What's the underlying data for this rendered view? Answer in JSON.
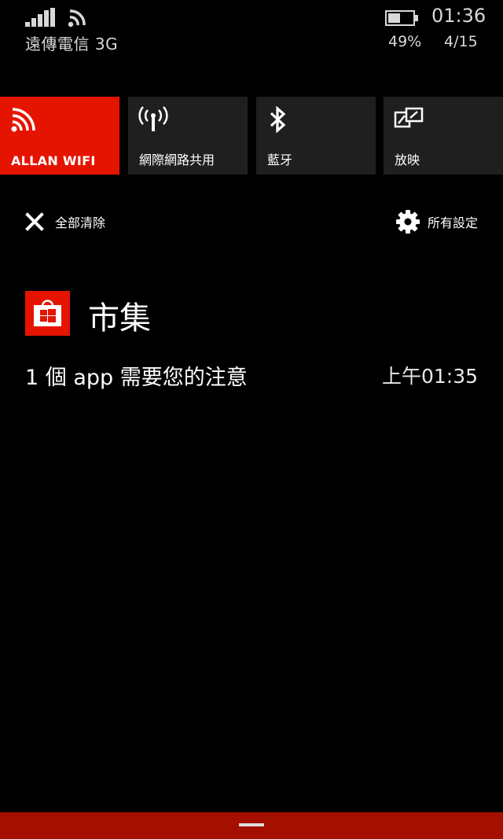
{
  "status_bar": {
    "carrier": "遠傳電信 3G",
    "time": "01:36",
    "battery_percent": "49%",
    "battery_level": 0.49,
    "date": "4/15",
    "icons": [
      "signal-strength-icon",
      "wifi-icon",
      "battery-icon"
    ]
  },
  "quick_actions": [
    {
      "label": "ALLAN WIFI",
      "icon": "wifi-icon",
      "active": true
    },
    {
      "label": "網際網路共用",
      "icon": "internet-sharing-icon",
      "active": false
    },
    {
      "label": "藍牙",
      "icon": "bluetooth-icon",
      "active": false
    },
    {
      "label": "放映",
      "icon": "project-screen-icon",
      "active": false
    }
  ],
  "actions": {
    "clear_all": "全部清除",
    "all_settings": "所有設定"
  },
  "notification": {
    "app_name": "市集",
    "app_icon": "store-icon",
    "message": "1 個 app 需要您的注意",
    "time": "上午01:35"
  },
  "colors": {
    "accent": "#e51400",
    "tile_bg": "#1f1f1f",
    "bottom_bar": "#a40f00",
    "background": "#000000"
  }
}
